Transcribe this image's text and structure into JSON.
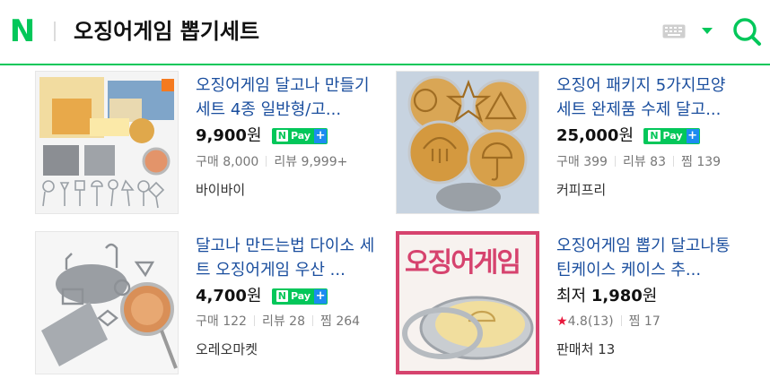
{
  "header": {
    "logo_letter": "N",
    "query": "오징어게임 뽑기세트"
  },
  "colors": {
    "brand_green": "#03c75a",
    "link_blue": "#1a4e9e",
    "npay_plus_blue": "#1c8cf0",
    "rating_star": "#e8183c"
  },
  "icons": [
    "keyboard-icon",
    "caret-down-icon",
    "search-icon",
    "star-icon"
  ],
  "products": [
    {
      "title": "오징어게임 달고나 만들기 세트 4종 일반형/고...",
      "price": "9,900",
      "unit": "원",
      "npay": "Pay",
      "stats": [
        {
          "label": "구매",
          "value": "8,000"
        },
        {
          "label": "리뷰",
          "value": "9,999+"
        }
      ],
      "seller": "바이바이"
    },
    {
      "title": "오징어 패키지 5가지모양 세트 완제품 수제 달고...",
      "price": "25,000",
      "unit": "원",
      "npay": "Pay",
      "stats": [
        {
          "label": "구매",
          "value": "399"
        },
        {
          "label": "리뷰",
          "value": "83"
        },
        {
          "label": "찜",
          "value": "139"
        }
      ],
      "seller": "커피프리"
    },
    {
      "title": "달고나 만드는법 다이소 세트 오징어게임 우산 ...",
      "price": "4,700",
      "unit": "원",
      "npay": "Pay",
      "stats": [
        {
          "label": "구매",
          "value": "122"
        },
        {
          "label": "리뷰",
          "value": "28"
        },
        {
          "label": "찜",
          "value": "264"
        }
      ],
      "seller": "오레오마켓"
    },
    {
      "title": "오징어게임 뽑기 달고나통 틴케이스 케이스 추...",
      "lowest_label": "최저",
      "price": "1,980",
      "unit": "원",
      "rating": "4.8(13)",
      "stats": [
        {
          "label": "찜",
          "value": "17"
        }
      ],
      "seller_count": "판매처 13",
      "thumb_text": "오징어게임"
    }
  ]
}
